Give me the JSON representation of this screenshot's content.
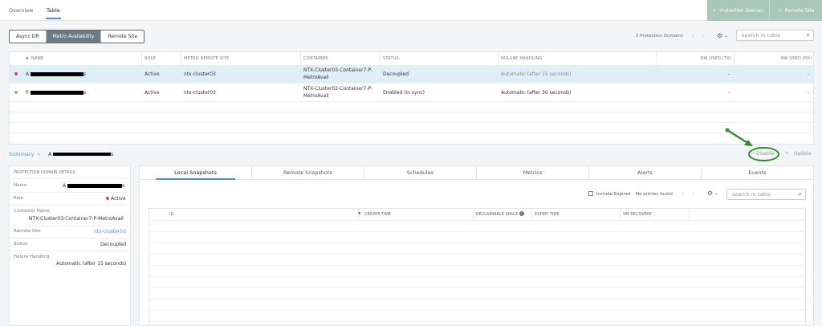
{
  "topnav": {
    "overview": "Overview",
    "table": "Table",
    "separator": "·"
  },
  "header_buttons": {
    "protection_domain": "Protection Domain",
    "remote_site": "Remote Site",
    "plus": "+"
  },
  "segments": [
    "Async DR",
    "Metro Availability",
    "Remote Site"
  ],
  "segment_selected": "Metro Availability",
  "toolbar": {
    "count": "2 Protection Domains",
    "prev": "‹",
    "next": "›",
    "gear": "⚙",
    "caret": "⌄",
    "search_placeholder": "search in table",
    "search_icon": "⌕"
  },
  "pd_table": {
    "sort_icon": "▲",
    "columns": [
      "NAME",
      "ROLE",
      "METRO REMOTE SITE",
      "CONTAINER",
      "STATUS",
      "FAILURE HANDLING",
      "BW USED (TX)",
      "BW USED (RX)"
    ],
    "rows": [
      {
        "name_start": "A",
        "name_end": "s",
        "role": "Active",
        "remote_site": "ntx-cluster03",
        "container": "NTX-Cluster03-Container7-P-MetroAvail",
        "status": "Decoupled",
        "failure_handling": "Automatic (after 15 seconds)",
        "bw_tx": "-",
        "bw_rx": "-",
        "dot_color": "#c0504d"
      },
      {
        "name_start": "P",
        "name_end": "s",
        "role": "Active",
        "remote_site": "ntx-cluster03",
        "container": "NTX-Cluster02-Container7-P-MetroAvail",
        "status": "Enabled (in sync)",
        "failure_handling": "Automatic (after 30 seconds)",
        "bw_tx": "-",
        "bw_rx": "-",
        "dot_color": "#8fbf6a"
      }
    ]
  },
  "summary": {
    "label": "Summary",
    "chev": "›",
    "name_start": "A",
    "name_end": "s",
    "disable": "Disable",
    "update": "Update",
    "disable_icon": "✓",
    "update_icon": "✎"
  },
  "details": {
    "title": "PROTECTION DOMAIN DETAILS",
    "name_label": "Name",
    "name_start": "A",
    "name_end": "s",
    "role_label": "Role",
    "role_value": "Active",
    "container_label": "Container Name",
    "container_value": "NTX-Cluster03-Container7-P-MetroAvail",
    "remote_label": "Remote Site",
    "remote_value": "ntx-cluster03",
    "status_label": "Status",
    "status_value": "Decoupled",
    "failure_label": "Failure Handling",
    "failure_value": "Automatic (after 15 seconds)"
  },
  "tabs": [
    "Local Snapshots",
    "Remote Snapshots",
    "Schedules",
    "Metrics",
    "Alerts",
    "Events"
  ],
  "snap_toolbar": {
    "include_expired": "Include Expired",
    "no_entries": "No entries found",
    "dash": "-",
    "search_placeholder": "search in table"
  },
  "snap_table": {
    "columns": [
      "ID",
      "CREATE TIME",
      "RECLAIMABLE SPACE",
      "EXPIRY TIME",
      "VM RECOVERY"
    ],
    "sort_icon": "▼",
    "info": "i"
  },
  "colors": {
    "accent": "#4c8fd0",
    "green_button": "#a9c8b9",
    "selected_row": "#dfeff7",
    "annotation": "#2e8b2e",
    "active_red": "#c0504d",
    "active_green": "#8fbf6a"
  }
}
